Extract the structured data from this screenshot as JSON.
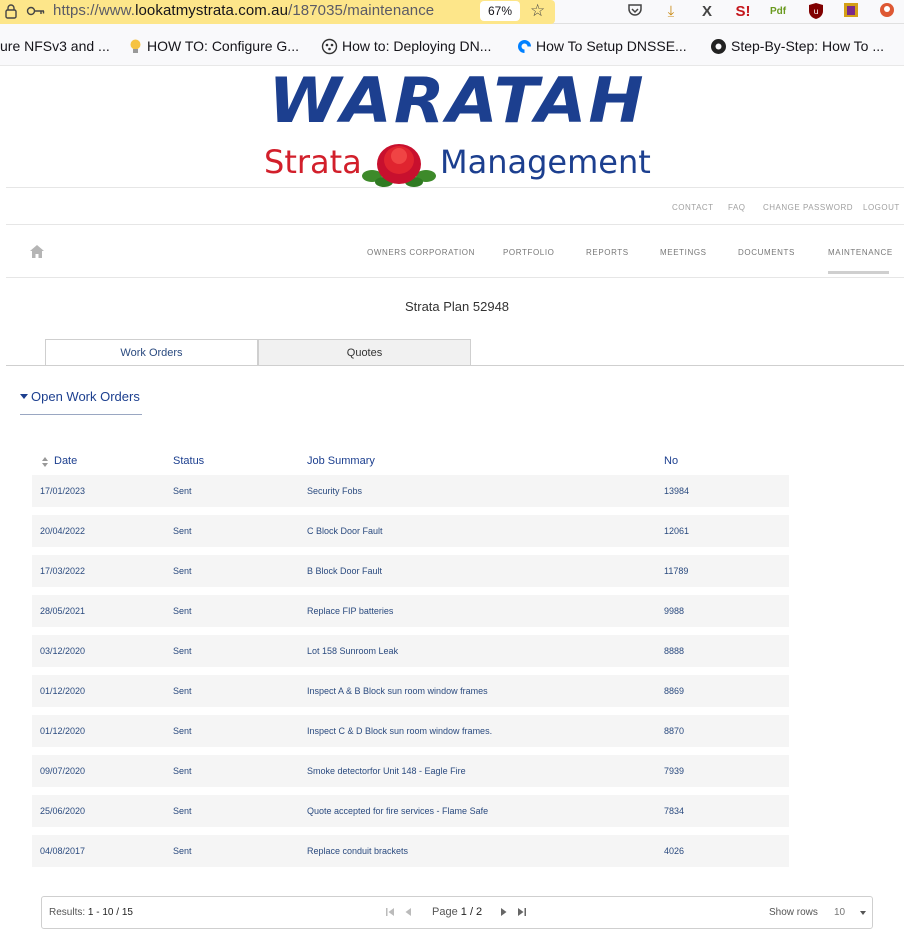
{
  "browser": {
    "url_prefix": "https://www.",
    "url_host": "lookatmystrata.com.au",
    "url_path": "/187035/maintenance",
    "zoom": "67%",
    "bookmarks": [
      {
        "label": "ure NFSv3 and ...",
        "icon": "none"
      },
      {
        "label": "HOW TO: Configure G...",
        "icon": "lightbulb-icon"
      },
      {
        "label": "How to: Deploying DN...",
        "icon": "dots-icon"
      },
      {
        "label": "How To Setup DNSSE...",
        "icon": "digitalocean-icon"
      },
      {
        "label": "Step-By-Step: How To ...",
        "icon": "gear-icon"
      }
    ]
  },
  "logo": {
    "main": "WARATAH",
    "left": "Strata",
    "right": "Management",
    "colors": {
      "blue": "#1c3f8f",
      "red": "#d21f2b"
    }
  },
  "utility_nav": [
    "CONTACT",
    "FAQ",
    "CHANGE PASSWORD",
    "LOGOUT"
  ],
  "main_nav": [
    "OWNERS CORPORATION",
    "PORTFOLIO",
    "REPORTS",
    "MEETINGS",
    "DOCUMENTS",
    "MAINTENANCE"
  ],
  "active_nav": "MAINTENANCE",
  "plan_title": "Strata Plan 52948",
  "tabs": [
    {
      "label": "Work Orders",
      "active": true
    },
    {
      "label": "Quotes",
      "active": false
    }
  ],
  "section": {
    "title": "Open Work Orders"
  },
  "table": {
    "headers": [
      "Date",
      "Status",
      "Job Summary",
      "No"
    ],
    "rows": [
      {
        "date": "17/01/2023",
        "status": "Sent",
        "summary": "Security Fobs",
        "no": "13984"
      },
      {
        "date": "20/04/2022",
        "status": "Sent",
        "summary": "C Block Door Fault",
        "no": "12061"
      },
      {
        "date": "17/03/2022",
        "status": "Sent",
        "summary": "B Block Door Fault",
        "no": "11789"
      },
      {
        "date": "28/05/2021",
        "status": "Sent",
        "summary": "Replace FIP batteries",
        "no": "9988"
      },
      {
        "date": "03/12/2020",
        "status": "Sent",
        "summary": "Lot 158 Sunroom Leak",
        "no": "8888"
      },
      {
        "date": "01/12/2020",
        "status": "Sent",
        "summary": "Inspect A & B Block sun room window frames",
        "no": "8869"
      },
      {
        "date": "01/12/2020",
        "status": "Sent",
        "summary": "Inspect C & D Block sun room window frames.",
        "no": "8870"
      },
      {
        "date": "09/07/2020",
        "status": "Sent",
        "summary": "Smoke detectorfor Unit 148 - Eagle Fire",
        "no": "7939"
      },
      {
        "date": "25/06/2020",
        "status": "Sent",
        "summary": "Quote accepted for fire services - Flame Safe",
        "no": "7834"
      },
      {
        "date": "04/08/2017",
        "status": "Sent",
        "summary": "Replace conduit brackets",
        "no": "4026"
      }
    ]
  },
  "pager": {
    "results_label": "Results:",
    "results_range": "1 - 10 / 15",
    "page_label": "Page",
    "page_value": "1 / 2",
    "show_rows_label": "Show rows",
    "rows_per_page": "10"
  }
}
